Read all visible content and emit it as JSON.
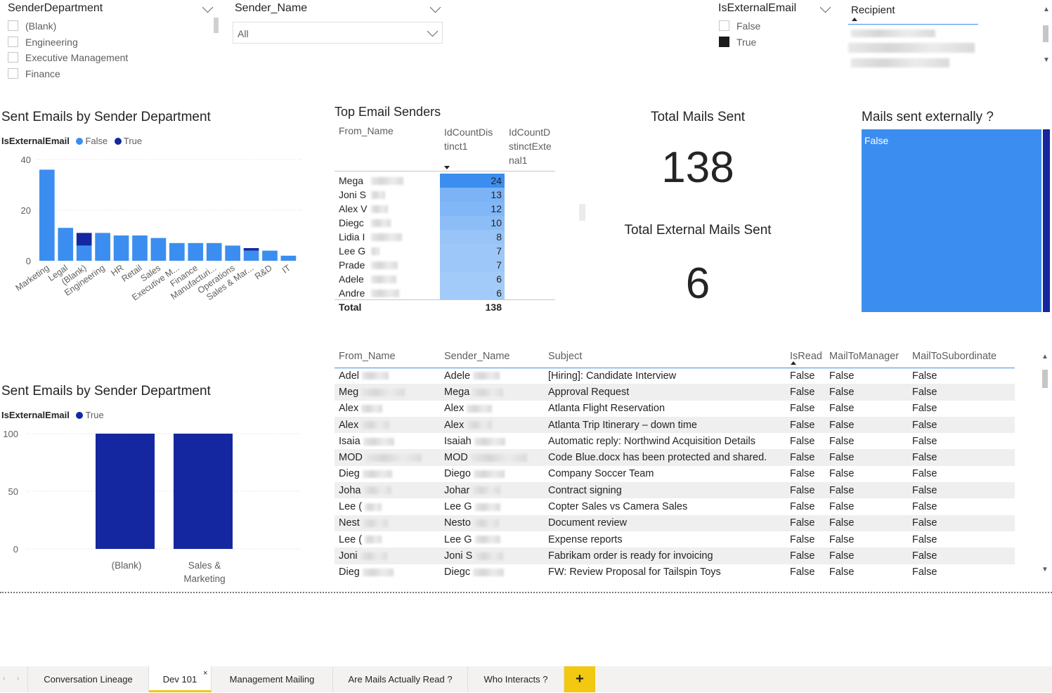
{
  "slicers": {
    "sender_department": {
      "title": "SenderDepartment",
      "options": [
        "(Blank)",
        "Engineering",
        "Executive Management",
        "Finance"
      ]
    },
    "sender_name": {
      "title": "Sender_Name",
      "value": "All"
    },
    "is_external": {
      "title": "IsExternalEmail",
      "options": [
        {
          "label": "False",
          "checked": false
        },
        {
          "label": "True",
          "checked": true
        }
      ]
    },
    "recipient": {
      "title": "Recipient"
    }
  },
  "colors": {
    "false_series": "#3b8ef0",
    "true_series": "#1427a0",
    "accent_tab": "#f2c811"
  },
  "chart_top": {
    "title": "Sent Emails by Sender Department",
    "legend_label": "IsExternalEmail",
    "chart_data": {
      "type": "bar",
      "stacked": true,
      "categories": [
        "Marketing",
        "Legal",
        "(Blank)",
        "Engineering",
        "HR",
        "Retail",
        "Sales",
        "Executive M...",
        "Finance",
        "Manufacturi...",
        "Operations",
        "Sales & Mar...",
        "R&D",
        "IT"
      ],
      "series": [
        {
          "name": "False",
          "values": [
            36,
            13,
            6,
            11,
            10,
            10,
            9,
            7,
            7,
            7,
            6,
            4,
            4,
            2
          ]
        },
        {
          "name": "True",
          "values": [
            0,
            0,
            5,
            0,
            0,
            0,
            0,
            0,
            0,
            0,
            0,
            1,
            0,
            0
          ]
        }
      ],
      "yticks": [
        "40",
        "20",
        "0"
      ],
      "ylim": [
        0,
        40
      ]
    }
  },
  "top_senders": {
    "title": "Top Email Senders",
    "headers": [
      "From_Name",
      "IdCountDistinct1",
      "IdCountDistinctExternal1"
    ],
    "header_lines": {
      "col2": [
        "IdCountDis",
        "tinct1"
      ],
      "col3": [
        "IdCountD",
        "stinctExte",
        "nal1"
      ]
    },
    "rows": [
      {
        "name": "Mega",
        "count": "24"
      },
      {
        "name": "Joni S",
        "count": "13"
      },
      {
        "name": "Alex V",
        "count": "12"
      },
      {
        "name": "Diegc",
        "count": "10"
      },
      {
        "name": "Lidia I",
        "count": "8"
      },
      {
        "name": "Lee G",
        "count": "7"
      },
      {
        "name": "Prade",
        "count": "7"
      },
      {
        "name": "Adele",
        "count": "6"
      },
      {
        "name": "Andre",
        "count": "6"
      }
    ],
    "total_label": "Total",
    "total_value": "138"
  },
  "kpis": {
    "total_title": "Total Mails Sent",
    "total_value": "138",
    "external_title": "Total External Mails Sent",
    "external_value": "6"
  },
  "treemap": {
    "title": "Mails sent externally ?",
    "label": "False",
    "chart_data": {
      "type": "treemap",
      "items": [
        {
          "name": "False",
          "value": 132
        },
        {
          "name": "True",
          "value": 6
        }
      ]
    }
  },
  "chart_bottom": {
    "title": "Sent Emails by Sender Department",
    "legend_label": "IsExternalEmail",
    "chart_data": {
      "type": "bar",
      "categories": [
        "(Blank)",
        "Sales & Marketing"
      ],
      "category_lines": [
        [
          "(Blank)"
        ],
        [
          "Sales &",
          "Marketing"
        ]
      ],
      "series": [
        {
          "name": "True",
          "values": [
            100,
            100
          ]
        }
      ],
      "yticks": [
        "100",
        "50",
        "0"
      ],
      "ylim": [
        0,
        100
      ]
    }
  },
  "mail_table": {
    "headers": [
      "From_Name",
      "Sender_Name",
      "Subject",
      "IsRead",
      "MailToManager",
      "MailToSubordinate"
    ],
    "rows": [
      {
        "from": "Adel",
        "sender": "Adele",
        "subject": "[Hiring]: Candidate Interview",
        "isread": "False",
        "mgr": "False",
        "sub": "False"
      },
      {
        "from": "Meg",
        "sender": "Mega",
        "subject": "Approval Request",
        "isread": "False",
        "mgr": "False",
        "sub": "False"
      },
      {
        "from": "Alex",
        "sender": "Alex",
        "subject": "Atlanta Flight Reservation",
        "isread": "False",
        "mgr": "False",
        "sub": "False"
      },
      {
        "from": "Alex",
        "sender": "Alex",
        "subject": "Atlanta Trip Itinerary – down time",
        "isread": "False",
        "mgr": "False",
        "sub": "False"
      },
      {
        "from": "Isaia",
        "sender": "Isaiah",
        "subject": "Automatic reply: Northwind Acquisition Details",
        "isread": "False",
        "mgr": "False",
        "sub": "False"
      },
      {
        "from": "MOD",
        "sender": "MOD",
        "subject": "Code Blue.docx has been protected and shared.",
        "isread": "False",
        "mgr": "False",
        "sub": "False"
      },
      {
        "from": "Dieg",
        "sender": "Diego",
        "subject": "Company Soccer Team",
        "isread": "False",
        "mgr": "False",
        "sub": "False"
      },
      {
        "from": "Joha",
        "sender": "Johar",
        "subject": "Contract signing",
        "isread": "False",
        "mgr": "False",
        "sub": "False"
      },
      {
        "from": "Lee (",
        "sender": "Lee G",
        "subject": "Copter Sales vs Camera Sales",
        "isread": "False",
        "mgr": "False",
        "sub": "False"
      },
      {
        "from": "Nest",
        "sender": "Nesto",
        "subject": "Document review",
        "isread": "False",
        "mgr": "False",
        "sub": "False"
      },
      {
        "from": "Lee (",
        "sender": "Lee G",
        "subject": "Expense reports",
        "isread": "False",
        "mgr": "False",
        "sub": "False"
      },
      {
        "from": "Joni",
        "sender": "Joni S",
        "subject": "Fabrikam order is ready for invoicing",
        "isread": "False",
        "mgr": "False",
        "sub": "False"
      },
      {
        "from": "Dieg",
        "sender": "Diegc",
        "subject": "FW: Review Proposal for Tailspin Toys",
        "isread": "False",
        "mgr": "False",
        "sub": "False"
      }
    ]
  },
  "tabs": [
    "Conversation Lineage",
    "Dev 101",
    "Management Mailing",
    "Are Mails Actually Read ?",
    "Who Interacts ?"
  ],
  "active_tab": "Dev 101",
  "add_tab_label": "+"
}
